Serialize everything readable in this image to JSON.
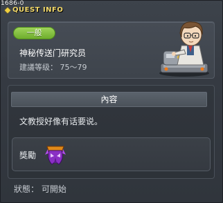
{
  "header": {
    "quest_id": "1686-0",
    "title": "QUEST INFO"
  },
  "quest": {
    "category": "一般",
    "npc_name": "神秘传送门研究员",
    "required_level": "建議等级： 75～79"
  },
  "content": {
    "header": "內容",
    "description": "文教授好像有话要说。",
    "reward_label": "獎勵",
    "reward_icon": "purple-mask-item-icon"
  },
  "status": "狀態： 可開始",
  "colors": {
    "category_pill": "#7fbf3a",
    "title_text": "#f3d96a"
  }
}
